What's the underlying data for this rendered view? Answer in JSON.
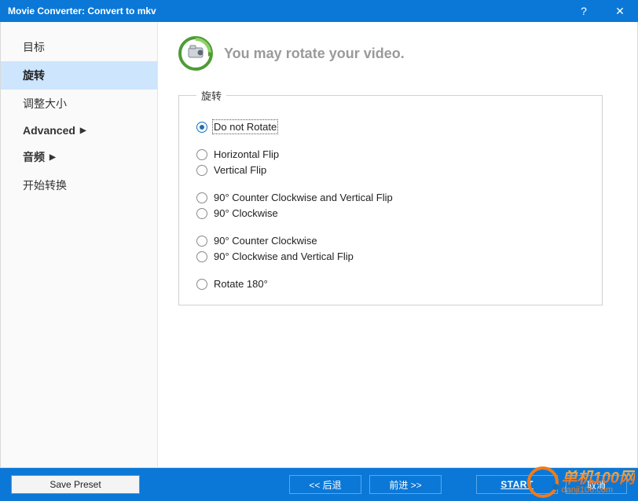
{
  "title": "Movie Converter:  Convert to mkv",
  "titlebar": {
    "help": "?",
    "close": "✕"
  },
  "sidebar": {
    "items": [
      {
        "label": "目标",
        "selected": false,
        "bold": false,
        "expandable": false
      },
      {
        "label": "旋转",
        "selected": true,
        "bold": true,
        "expandable": false
      },
      {
        "label": "调整大小",
        "selected": false,
        "bold": false,
        "expandable": false
      },
      {
        "label": "Advanced",
        "selected": false,
        "bold": true,
        "expandable": true
      },
      {
        "label": "音频",
        "selected": false,
        "bold": true,
        "expandable": true
      },
      {
        "label": "开始转换",
        "selected": false,
        "bold": false,
        "expandable": false
      }
    ]
  },
  "header": {
    "text": "You may rotate your video."
  },
  "group": {
    "legend": "旋转",
    "options": [
      {
        "label": "Do not Rotate",
        "checked": true
      },
      {
        "label": "Horizontal Flip",
        "checked": false,
        "gapBefore": true
      },
      {
        "label": "Vertical Flip",
        "checked": false
      },
      {
        "label": "90° Counter Clockwise and Vertical Flip",
        "checked": false,
        "gapBefore": true
      },
      {
        "label": "90° Clockwise",
        "checked": false
      },
      {
        "label": "90° Counter Clockwise",
        "checked": false,
        "gapBefore": true
      },
      {
        "label": "90° Clockwise and Vertical Flip",
        "checked": false
      },
      {
        "label": "Rotate 180°",
        "checked": false,
        "gapBefore": true
      }
    ]
  },
  "footer": {
    "save": "Save Preset",
    "back": "<<  后退",
    "next": "前进  >>",
    "start": "START",
    "cancel": "取消"
  },
  "watermark": {
    "cn": "单机100网",
    "en": "danji100.com"
  }
}
